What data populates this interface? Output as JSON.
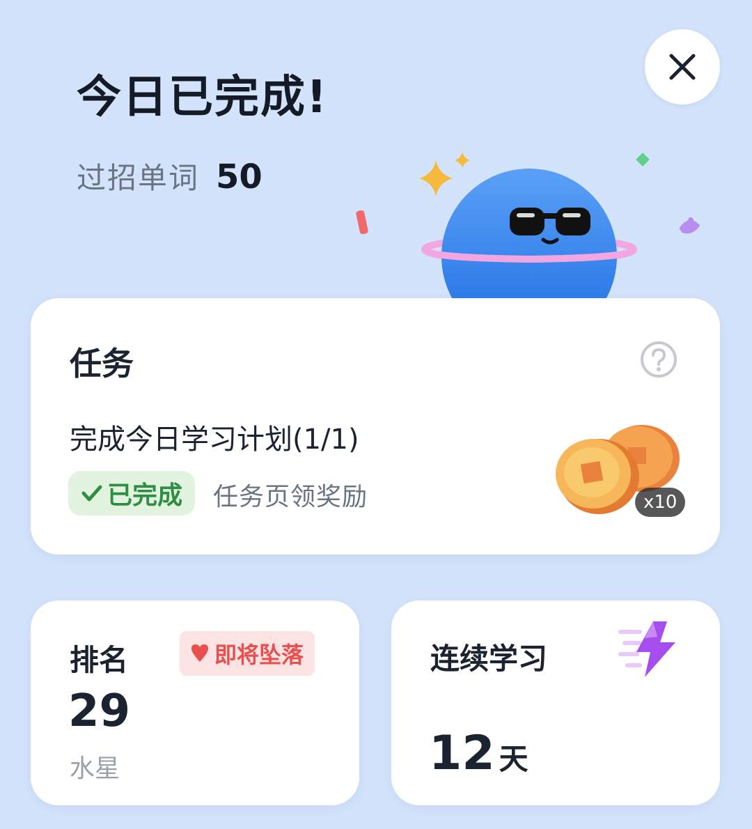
{
  "header": {
    "title": "今日已完成!",
    "words_label": "过招单词",
    "words_value": "50"
  },
  "icons": {
    "close": "close-icon",
    "mascot": "planet-mascot-sunglasses",
    "help": "question-circle-icon",
    "check": "check-icon",
    "coins": "coins-icon",
    "heart": "heart-down-icon",
    "bolt": "lightning-bolt-icon"
  },
  "task_card": {
    "title": "任务",
    "task_name": "完成今日学习计划(1/1)",
    "status_label": "已完成",
    "hint": "任务页领奖励",
    "reward_count": "x10"
  },
  "rank_card": {
    "title": "排名",
    "badge": "即将坠落",
    "value": "29",
    "league": "水星"
  },
  "streak_card": {
    "title": "连续学习",
    "value": "12",
    "unit": "天"
  },
  "colors": {
    "background": "#d3e3fb",
    "card": "#ffffff",
    "success_green": "#2e8f42",
    "success_bg": "#e2f4df",
    "warning_red": "#e8504f",
    "warning_bg": "#fde4e4",
    "mascot_blue": "#2f80ee",
    "ring_pink": "#f3a7e0",
    "coin_orange": "#f0a24a",
    "bolt_purple": "#a64df0"
  }
}
